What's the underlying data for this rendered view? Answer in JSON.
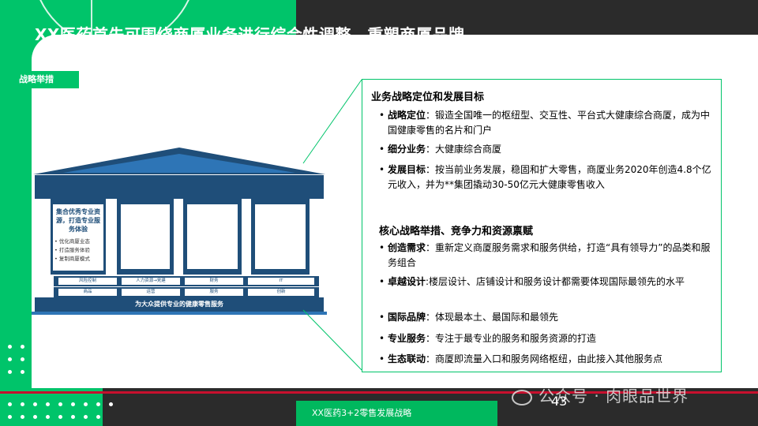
{
  "slide": {
    "title": "XX医药首先可围绕商厦业务进行综合性调整，重塑商厦品牌",
    "tag": "战略举措",
    "page_number": "43",
    "footer": "XX医药3+2零售发展战略",
    "watermark": "公众号 · 肉眼品世界"
  },
  "colors": {
    "accent_green": "#00c46a",
    "navy": "#1f4e79",
    "red_rule": "#c8102e",
    "dark_bg": "#2b2b2b"
  },
  "diagram": {
    "pillar1_title": "集合优秀专业资源，打造专业服务体验",
    "pillar1_items": [
      "优化商厦业态",
      "打造服务体验",
      "复制商厦模式"
    ],
    "band_top": [
      "风险控制",
      "人力资源→党建",
      "财务",
      "IT"
    ],
    "band_bottom": [
      "商品",
      "运营",
      "服务",
      "创新"
    ],
    "base": "为大众提供专业的健康零售服务"
  },
  "right_panel": {
    "section1_title": "业务战略定位和发展目标",
    "section1_items": [
      {
        "label": "战略定位",
        "text": "：锻造全国唯一的枢纽型、交互性、平台式大健康综合商厦，成为中国健康零售的名片和门户"
      },
      {
        "label": "细分业务",
        "text": "：大健康综合商厦"
      },
      {
        "label": "发展目标",
        "text": "：按当前业务发展，稳固和扩大零售，商厦业务2020年创造4.8个亿元收入，并为**集团撬动30-50亿元大健康零售收入"
      }
    ],
    "section2_title": "核心战略举措、竞争力和资源禀赋",
    "section2_items": [
      {
        "label": "创造需求",
        "text": "：重新定义商厦服务需求和服务供给，打造“具有领导力”的品类和服务组合"
      },
      {
        "label": "卓越设计",
        "text": ":楼层设计、店铺设计和服务设计都需要体现国际最领先的水平"
      },
      {
        "label": "国际品牌",
        "text": "：体现最本土、最国际和最领先"
      },
      {
        "label": "专业服务",
        "text": "：专注于最专业的服务和服务资源的打造"
      },
      {
        "label": "生态联动",
        "text": "：商厦即流量入口和服务网络枢纽，由此接入其他服务点"
      }
    ]
  }
}
